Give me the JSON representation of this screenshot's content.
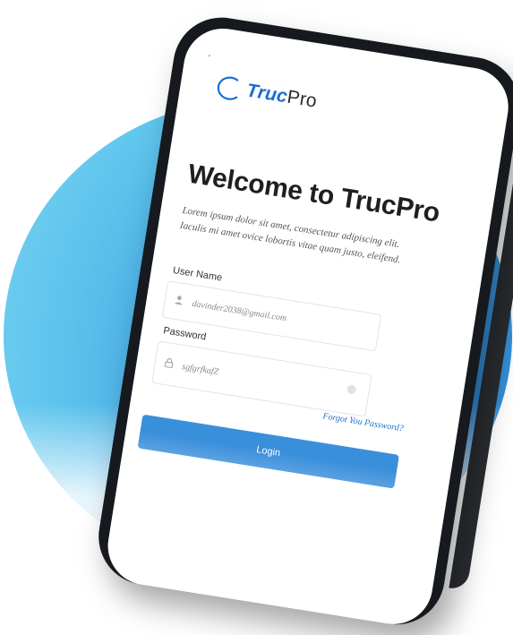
{
  "brand": {
    "logo_prefix": "Truc",
    "logo_suffix": "Pro"
  },
  "status": {
    "tick": "'"
  },
  "welcome": {
    "title": "Welcome to TrucPro",
    "description": "Lorem ipsum dolor sit amet, consectetur adipiscing elit. Iaculis mi amet ovice lobortis vitae quam justo, eleifend."
  },
  "form": {
    "username": {
      "label": "User Name",
      "value": "davinder2038@gmail.com",
      "icon": "user-icon"
    },
    "password": {
      "label": "Password",
      "value": "sgfgrfkafZ",
      "icon": "lock-icon"
    },
    "forgot_link": "Forgot You Password?",
    "login_button": "Login"
  },
  "colors": {
    "accent": "#3a8fdb",
    "logo_blue": "#1a6fd0",
    "circle_light": "#7bd5f3",
    "circle_dark": "#2e7fd0",
    "phone_frame": "#16191d"
  }
}
